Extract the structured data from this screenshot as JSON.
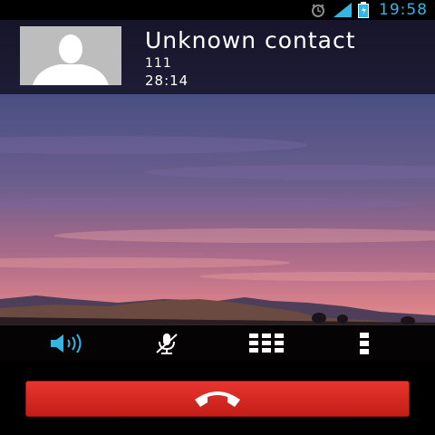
{
  "status_bar": {
    "time": "19:58",
    "icons": [
      "alarm-icon",
      "signal-icon",
      "battery-icon"
    ]
  },
  "caller": {
    "name": "Unknown contact",
    "number": "111",
    "duration": "28:14",
    "avatar_icon": "person-silhouette-icon"
  },
  "controls": [
    {
      "icon": "speaker-icon",
      "active": true
    },
    {
      "icon": "mute-mic-icon",
      "active": false
    },
    {
      "icon": "dialpad-icon",
      "active": false
    },
    {
      "icon": "overflow-menu-icon",
      "active": false
    }
  ],
  "end_call": {
    "icon": "end-call-icon"
  },
  "colors": {
    "accent": "#33b5e5",
    "end_call": "#d9261f",
    "avatar_bg": "#bdbdbd"
  }
}
